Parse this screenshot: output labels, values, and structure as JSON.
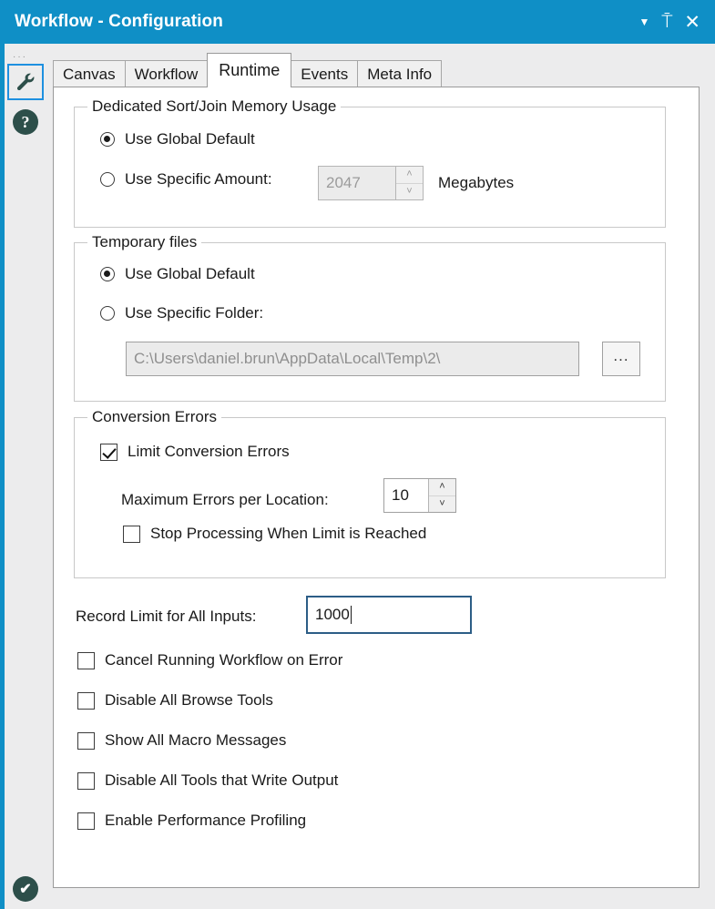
{
  "window": {
    "title": "Workflow - Configuration",
    "actions": [
      {
        "name": "dropdown-caret",
        "glyph": "▼"
      },
      {
        "name": "pin",
        "glyph": "⍑"
      },
      {
        "name": "close",
        "glyph": "✕"
      }
    ],
    "accent_color": "#0f8fc6"
  },
  "left_rail": {
    "drag_dots": "···",
    "items": [
      {
        "name": "configuration-wrench",
        "glyph": "🔧",
        "selected": true
      },
      {
        "name": "help",
        "glyph": "?",
        "selected": false
      }
    ],
    "status": {
      "name": "status-ok",
      "glyph": "✔"
    }
  },
  "tabs": [
    {
      "label": "Canvas",
      "active": false
    },
    {
      "label": "Workflow",
      "active": false
    },
    {
      "label": "Runtime",
      "active": true
    },
    {
      "label": "Events",
      "active": false
    },
    {
      "label": "Meta Info",
      "active": false
    }
  ],
  "memory_group": {
    "legend": "Dedicated Sort/Join Memory Usage",
    "option_global": "Use Global Default",
    "option_specific": "Use Specific Amount:",
    "selected": "global",
    "amount_value": "2047",
    "amount_disabled": true,
    "units": "Megabytes",
    "spin_up": "˄",
    "spin_down": "˅"
  },
  "temp_group": {
    "legend": "Temporary files",
    "option_global": "Use Global Default",
    "option_specific": "Use Specific Folder:",
    "selected": "global",
    "folder_value": "C:\\Users\\daniel.brun\\AppData\\Local\\Temp\\2\\",
    "folder_disabled": true,
    "browse_label": "..."
  },
  "conversion_group": {
    "legend": "Conversion Errors",
    "limit_errors_label": "Limit Conversion Errors",
    "limit_errors_checked": true,
    "max_errors_label": "Maximum Errors per Location:",
    "max_errors_value": "10",
    "stop_processing_label": "Stop Processing When Limit is Reached",
    "stop_processing_checked": false,
    "spin_up": "˄",
    "spin_down": "˅"
  },
  "record_limit": {
    "label": "Record Limit for All Inputs:",
    "value": "1000",
    "focused": true
  },
  "options": [
    {
      "label": "Cancel Running Workflow on Error",
      "checked": false
    },
    {
      "label": "Disable All Browse Tools",
      "checked": false
    },
    {
      "label": "Show All Macro Messages",
      "checked": false
    },
    {
      "label": "Disable All Tools that Write Output",
      "checked": false
    },
    {
      "label": "Enable Performance Profiling",
      "checked": false
    }
  ]
}
